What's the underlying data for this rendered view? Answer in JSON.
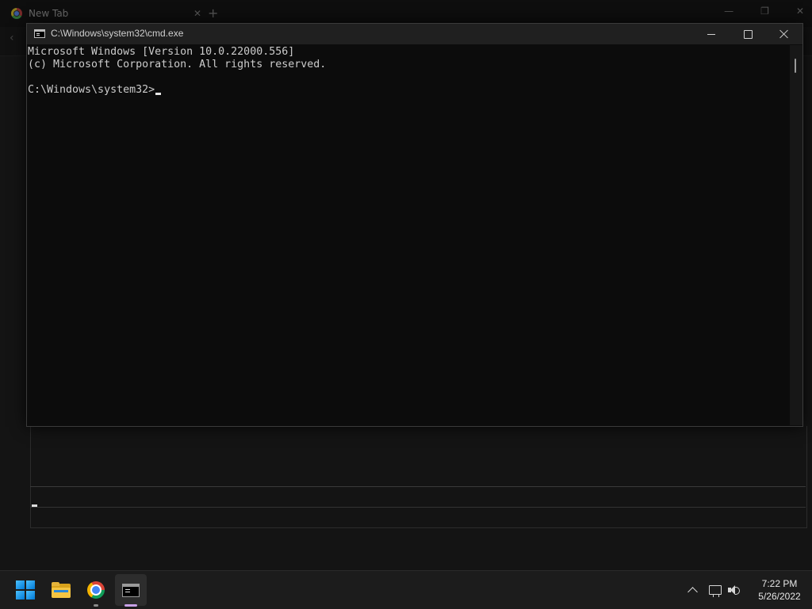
{
  "background_browser": {
    "tab_title": "New Tab",
    "tab_close": "✕",
    "new_tab": "+",
    "window_buttons": [
      "—",
      "❐",
      "✕"
    ]
  },
  "cmd_window": {
    "title": "C:\\Windows\\system32\\cmd.exe",
    "lines": [
      "Microsoft Windows [Version 10.0.22000.556]",
      "(c) Microsoft Corporation. All rights reserved.",
      "C:\\Windows\\system32>"
    ]
  },
  "taskbar": {
    "apps": [
      "start",
      "file-explorer",
      "chrome",
      "command-prompt"
    ],
    "clock": {
      "time": "7:22 PM",
      "date": "5/26/2022"
    }
  },
  "colors": {
    "console_bg": "#0c0c0c",
    "console_text": "#cccccc",
    "titlebar_bg": "#202020",
    "taskbar_bg": "#1c1c1c",
    "accent": "#0078d4"
  },
  "icons": [
    "chrome-icon",
    "windows-start-icon",
    "folder-icon",
    "cmd-icon",
    "chevron-up-icon",
    "network-icon",
    "volume-icon",
    "minimize-icon",
    "maximize-icon",
    "close-icon"
  ]
}
